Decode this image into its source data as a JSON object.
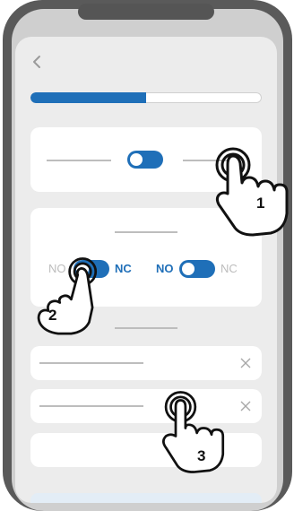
{
  "header": {
    "back_icon": "chevron-left-icon"
  },
  "progress": {
    "value": 0.5
  },
  "toggle_row_1": {
    "state": "on"
  },
  "switch_card": {
    "left_switch": {
      "label_no": "NO",
      "label_nc": "NC",
      "active": "NC"
    },
    "right_switch": {
      "label_no": "NO",
      "label_nc": "NC",
      "active": "NO"
    }
  },
  "list_items": [
    {
      "close_icon": "close-icon"
    },
    {
      "close_icon": "close-icon"
    },
    {}
  ],
  "gestures": [
    {
      "number": "1",
      "icon": "tap-hand-icon"
    },
    {
      "number": "2",
      "icon": "tap-hand-icon"
    },
    {
      "number": "3",
      "icon": "tap-hand-icon"
    }
  ],
  "colors": {
    "accent": "#1f6fb8",
    "background": "#ececec",
    "inactive": "#bdbdbd"
  }
}
